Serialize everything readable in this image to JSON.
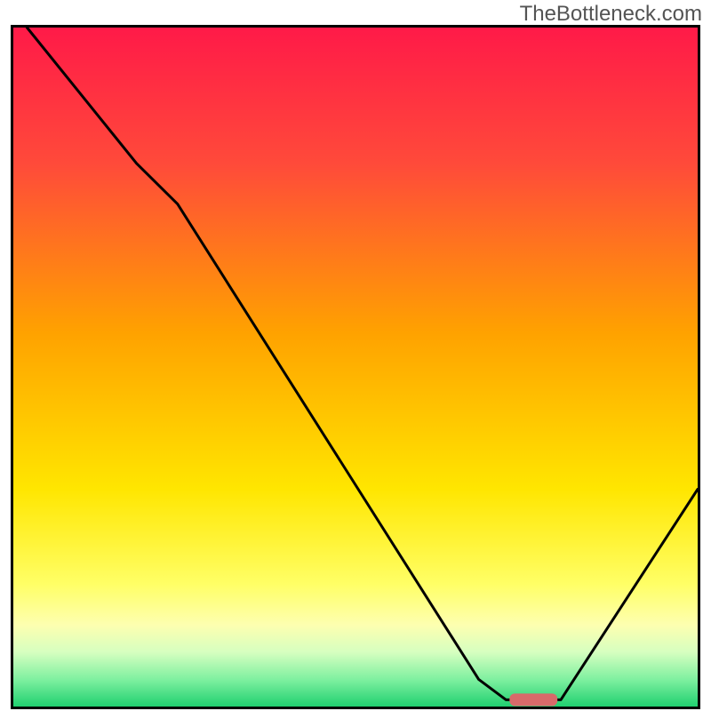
{
  "watermark": "TheBottleneck.com",
  "chart_data": {
    "type": "line",
    "title": "",
    "xlabel": "",
    "ylabel": "",
    "legend": null,
    "x_range": [
      0,
      100
    ],
    "y_range": [
      0,
      100
    ],
    "curve": {
      "name": "bottleneck-curve",
      "points_xy": [
        [
          2,
          100
        ],
        [
          18,
          80
        ],
        [
          24,
          74
        ],
        [
          68,
          4
        ],
        [
          72,
          1
        ],
        [
          80,
          1
        ],
        [
          100,
          32
        ]
      ]
    },
    "marker": {
      "name": "optimal-marker",
      "x_center": 76,
      "width": 7,
      "y": 1,
      "color": "#d86a6a"
    },
    "gradient_stops": [
      {
        "offset": 0.0,
        "color": "#ff1a48"
      },
      {
        "offset": 0.2,
        "color": "#ff4a3a"
      },
      {
        "offset": 0.45,
        "color": "#ffa200"
      },
      {
        "offset": 0.68,
        "color": "#ffe600"
      },
      {
        "offset": 0.82,
        "color": "#ffff66"
      },
      {
        "offset": 0.88,
        "color": "#fdffb0"
      },
      {
        "offset": 0.92,
        "color": "#d6ffc0"
      },
      {
        "offset": 0.96,
        "color": "#7ff0a0"
      },
      {
        "offset": 1.0,
        "color": "#20d070"
      }
    ],
    "frame_color": "#000000",
    "line_color": "#000000"
  }
}
